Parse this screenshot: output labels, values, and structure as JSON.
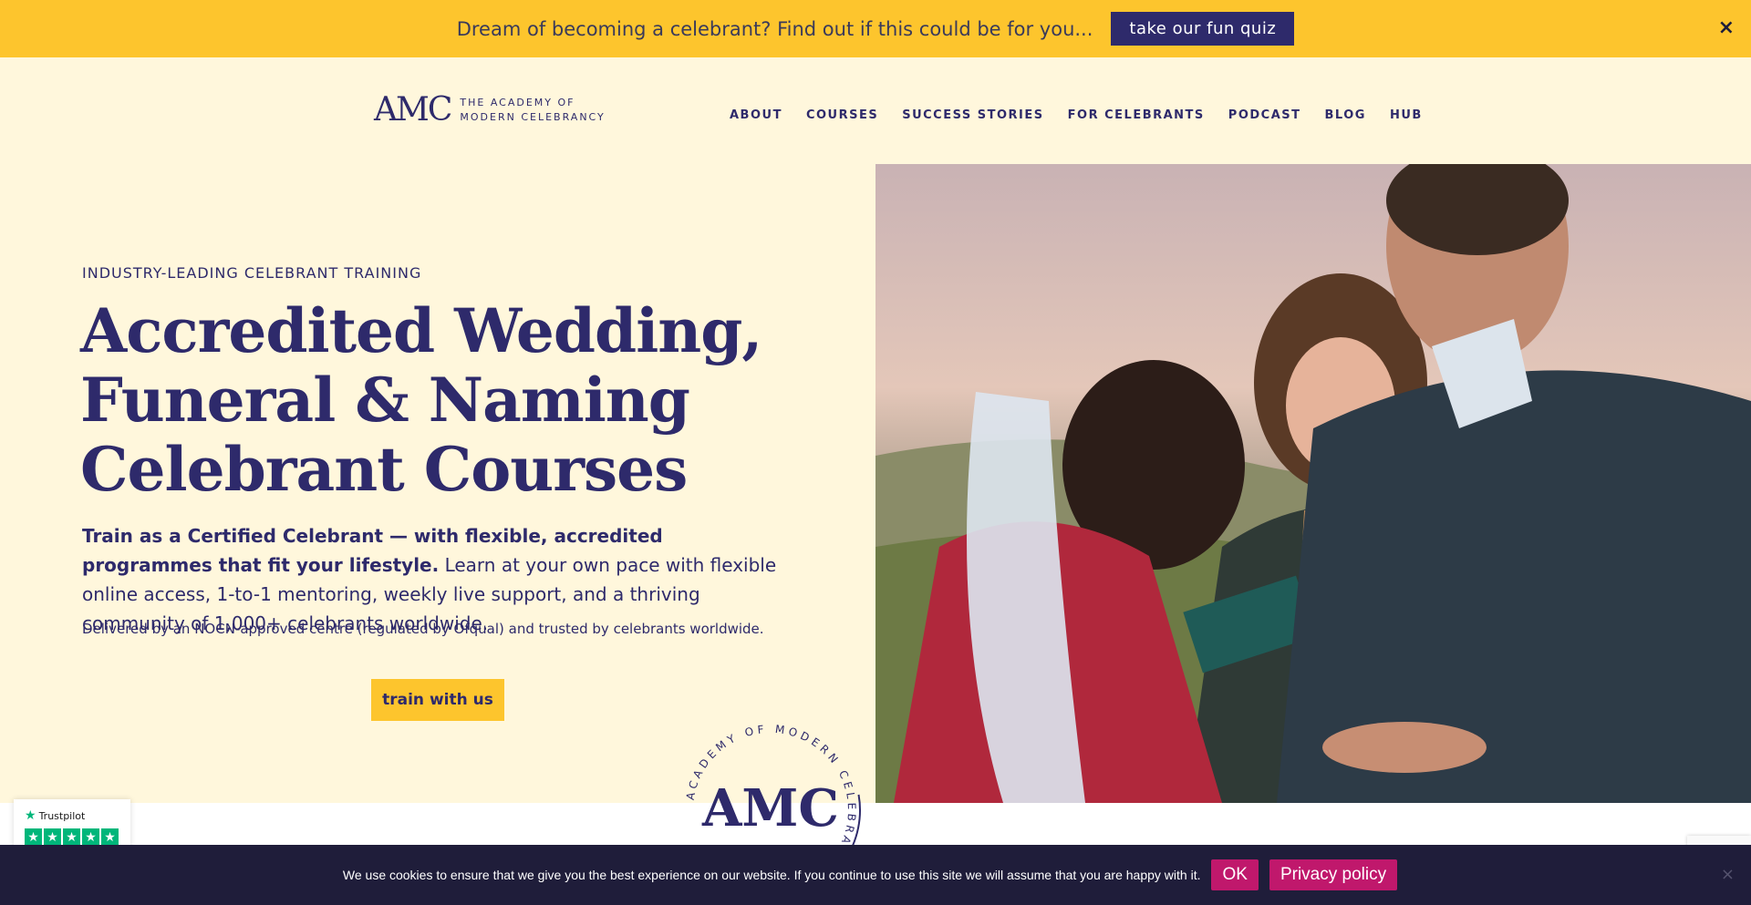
{
  "banner": {
    "text": "Dream of becoming a celebrant? Find out if this could be for you...",
    "button_label": "take our fun quiz",
    "close_glyph": "×"
  },
  "header": {
    "logo_mark": "AMC",
    "logo_line1": "THE ACADEMY OF",
    "logo_line2": "MODERN CELEBRANCY",
    "nav": [
      "ABOUT",
      "COURSES",
      "SUCCESS STORIES",
      "FOR CELEBRANTS",
      "PODCAST",
      "BLOG",
      "HUB"
    ]
  },
  "hero": {
    "eyebrow": "INDUSTRY-LEADING CELEBRANT TRAINING",
    "headline_line1": "Accredited Wedding,",
    "headline_line2": "Funeral & Naming",
    "headline_line3": "Celebrant Courses",
    "lead_bold": "Train as a Certified Celebrant — with flexible, accredited programmes that fit your lifestyle.",
    "lead_rest": " Learn at your own pace with flexible online access, 1-to-1 mentoring, weekly live support, and a thriving community of 1,000+ celebrants worldwide.",
    "sub": "Delivered by an NOCN-approved centre (regulated by Ofqual) and trusted by celebrants worldwide.",
    "cta_label": "train with us"
  },
  "badge": {
    "ring_text": "ACADEMY OF MODERN CELEBRANCY",
    "mark": "AMC"
  },
  "trustpilot": {
    "label": "Trustpilot",
    "rating_stars": 5
  },
  "cookie": {
    "text": "We use cookies to ensure that we give you the best experience on our website. If you continue to use this site we will assume that you are happy with it.",
    "ok_label": "OK",
    "privacy_label": "Privacy policy",
    "close_glyph": "×"
  },
  "colors": {
    "brand_navy": "#2e2a6b",
    "brand_yellow": "#fdc52d",
    "cream": "#fff7dc",
    "cookie_bg": "#1f1d3a",
    "cookie_btn": "#c0186c",
    "trustpilot_green": "#00b67a"
  }
}
